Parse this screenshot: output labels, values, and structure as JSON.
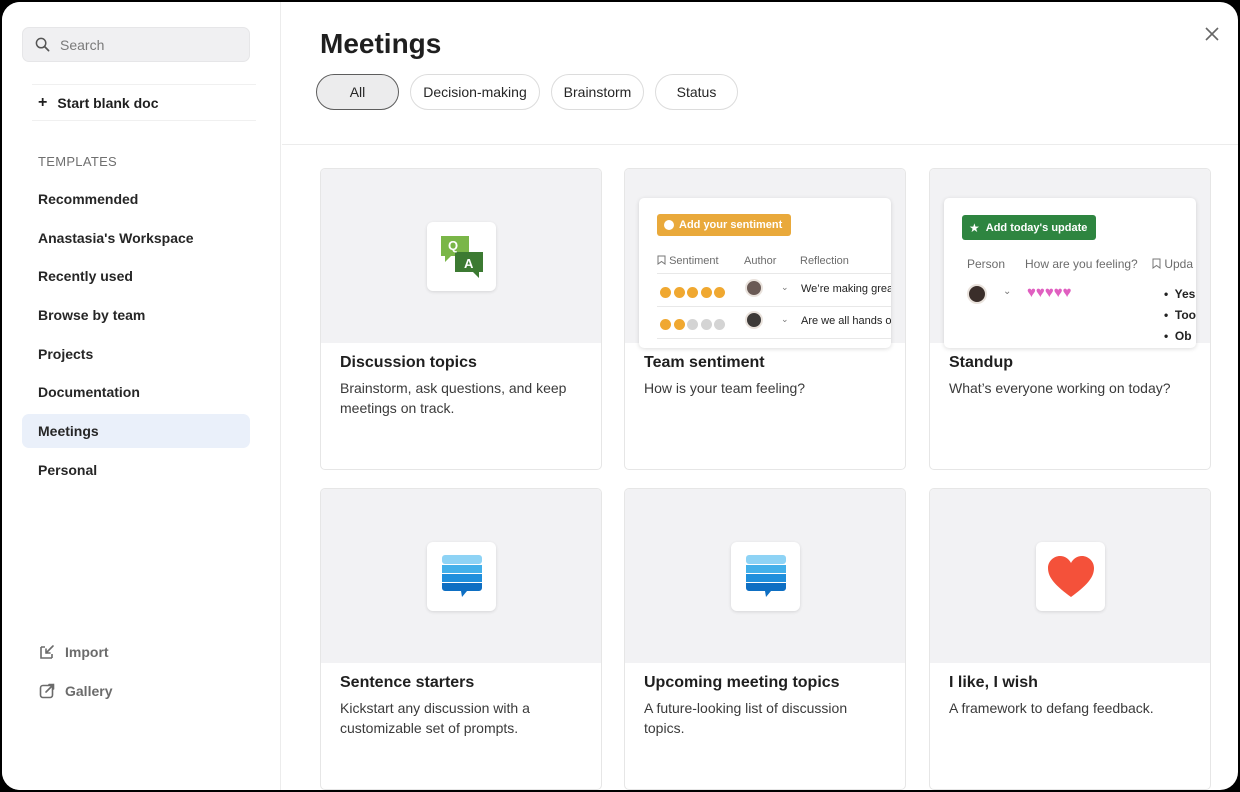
{
  "sidebar": {
    "search_placeholder": "Search",
    "start_blank_label": "Start blank doc",
    "section_label": "TEMPLATES",
    "items": [
      {
        "label": "Recommended",
        "active": false
      },
      {
        "label": "Anastasia's Workspace",
        "active": false
      },
      {
        "label": "Recently used",
        "active": false
      },
      {
        "label": "Browse by team",
        "active": false
      },
      {
        "label": "Projects",
        "active": false
      },
      {
        "label": "Documentation",
        "active": false
      },
      {
        "label": "Meetings",
        "active": true
      },
      {
        "label": "Personal",
        "active": false
      }
    ],
    "import_label": "Import",
    "gallery_label": "Gallery"
  },
  "main": {
    "title": "Meetings",
    "filters": [
      {
        "label": "All",
        "active": true
      },
      {
        "label": "Decision-making",
        "active": false
      },
      {
        "label": "Brainstorm",
        "active": false
      },
      {
        "label": "Status",
        "active": false
      }
    ],
    "cards": [
      {
        "title": "Discussion topics",
        "description": "Brainstorm, ask questions, and keep meetings on track.",
        "icon": "qa-bubbles-icon"
      },
      {
        "title": "Team sentiment",
        "description": "How is your team feeling?",
        "icon": "sentiment-preview"
      },
      {
        "title": "Standup",
        "description": "What’s everyone working on today?",
        "icon": "standup-preview"
      },
      {
        "title": "Sentence starters",
        "description": "Kickstart any discussion with a customizable set of prompts.",
        "icon": "stacked-chat-icon"
      },
      {
        "title": "Upcoming meeting topics",
        "description": "A future-looking list of discussion topics.",
        "icon": "stacked-chat-icon"
      },
      {
        "title": "I like, I wish",
        "description": "A framework to defang feedback.",
        "icon": "heart-icon"
      }
    ],
    "sentiment_preview": {
      "button": "Add your sentiment",
      "columns": [
        "Sentiment",
        "Author",
        "Reflection"
      ],
      "rows": [
        "We’re making great",
        "Are we all hands or"
      ]
    },
    "standup_preview": {
      "button": "Add today's update",
      "columns": [
        "Person",
        "How are you feeling?",
        "Upda"
      ],
      "bullets": [
        "Yes",
        "Too",
        "Ob"
      ]
    },
    "qa_icon_letters": {
      "q": "Q",
      "a": "A"
    }
  },
  "colors": {
    "active_nav_bg": "#eaf0fa",
    "sentiment_button": "#e9a93b",
    "standup_button": "#2e8540",
    "heart": "#f4513a",
    "heart_small": "#e05fc0"
  }
}
